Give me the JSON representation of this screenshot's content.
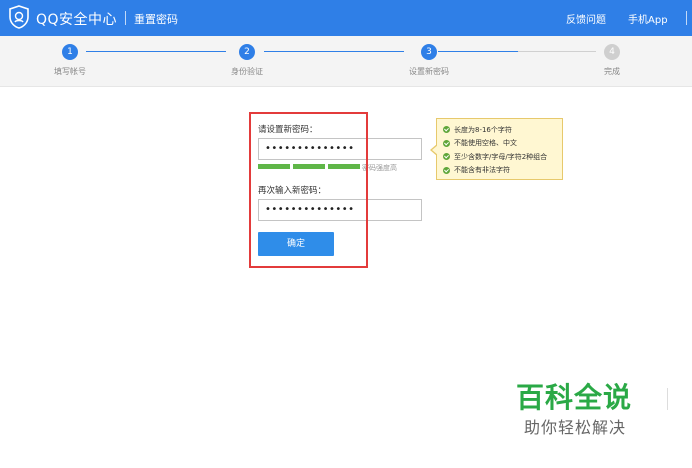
{
  "header": {
    "brand": "QQ安全中心",
    "page_name": "重置密码",
    "links": [
      "反馈问题",
      "手机App"
    ]
  },
  "steps": [
    {
      "number": "1",
      "label": "填写帐号",
      "state": "done"
    },
    {
      "number": "2",
      "label": "身份验证",
      "state": "done"
    },
    {
      "number": "3",
      "label": "设置新密码",
      "state": "current"
    },
    {
      "number": "4",
      "label": "完成",
      "state": "pending"
    }
  ],
  "form": {
    "new_password_label": "请设置新密码：",
    "new_password_value": "••••••••••••••",
    "strength_text": "密码强度高",
    "strength_level": "high",
    "confirm_label": "再次输入新密码：",
    "confirm_value": "••••••••••••••",
    "submit_label": "确定"
  },
  "tooltip": {
    "rules": [
      "长度为8-16个字符",
      "不能使用空格、中文",
      "至少含数字/字母/字符2种组合",
      "不能含有非法字符"
    ]
  },
  "watermark": {
    "title": "百科全说",
    "subtitle": "助你轻松解决"
  },
  "colors": {
    "primary": "#2f7fe7",
    "strength": "#5fb648",
    "highlight": "#e33b3b",
    "tooltip_bg": "#fff7d2",
    "watermark": "#2aa946"
  }
}
